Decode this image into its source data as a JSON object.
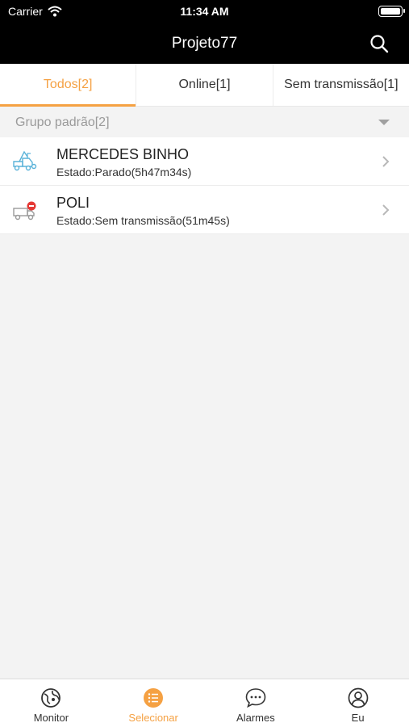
{
  "status_bar": {
    "carrier": "Carrier",
    "time": "11:34 AM"
  },
  "nav": {
    "title": "Projeto77",
    "search_icon": "search-icon"
  },
  "tabs": [
    {
      "label": "Todos[2]",
      "active": true
    },
    {
      "label": "Online[1]",
      "active": false
    },
    {
      "label": "Sem transmissão[1]",
      "active": false
    }
  ],
  "group": {
    "label": "Grupo padrão[2]"
  },
  "vehicles": [
    {
      "name": "MERCEDES BINHO",
      "state": "Estado:Parado(5h47m34s)",
      "icon": "truck-stopped-icon"
    },
    {
      "name": "POLI",
      "state": "Estado:Sem transmissão(51m45s)",
      "icon": "truck-offline-icon"
    }
  ],
  "bottom_tabs": [
    {
      "label": "Monitor",
      "icon": "monitor-globe-icon",
      "active": false
    },
    {
      "label": "Selecionar",
      "icon": "list-icon",
      "active": true
    },
    {
      "label": "Alarmes",
      "icon": "chat-bubble-icon",
      "active": false
    },
    {
      "label": "Eu",
      "icon": "user-icon",
      "active": false
    }
  ],
  "colors": {
    "accent": "#f5a143",
    "header_bg": "#000000",
    "background": "#f3f3f3"
  }
}
